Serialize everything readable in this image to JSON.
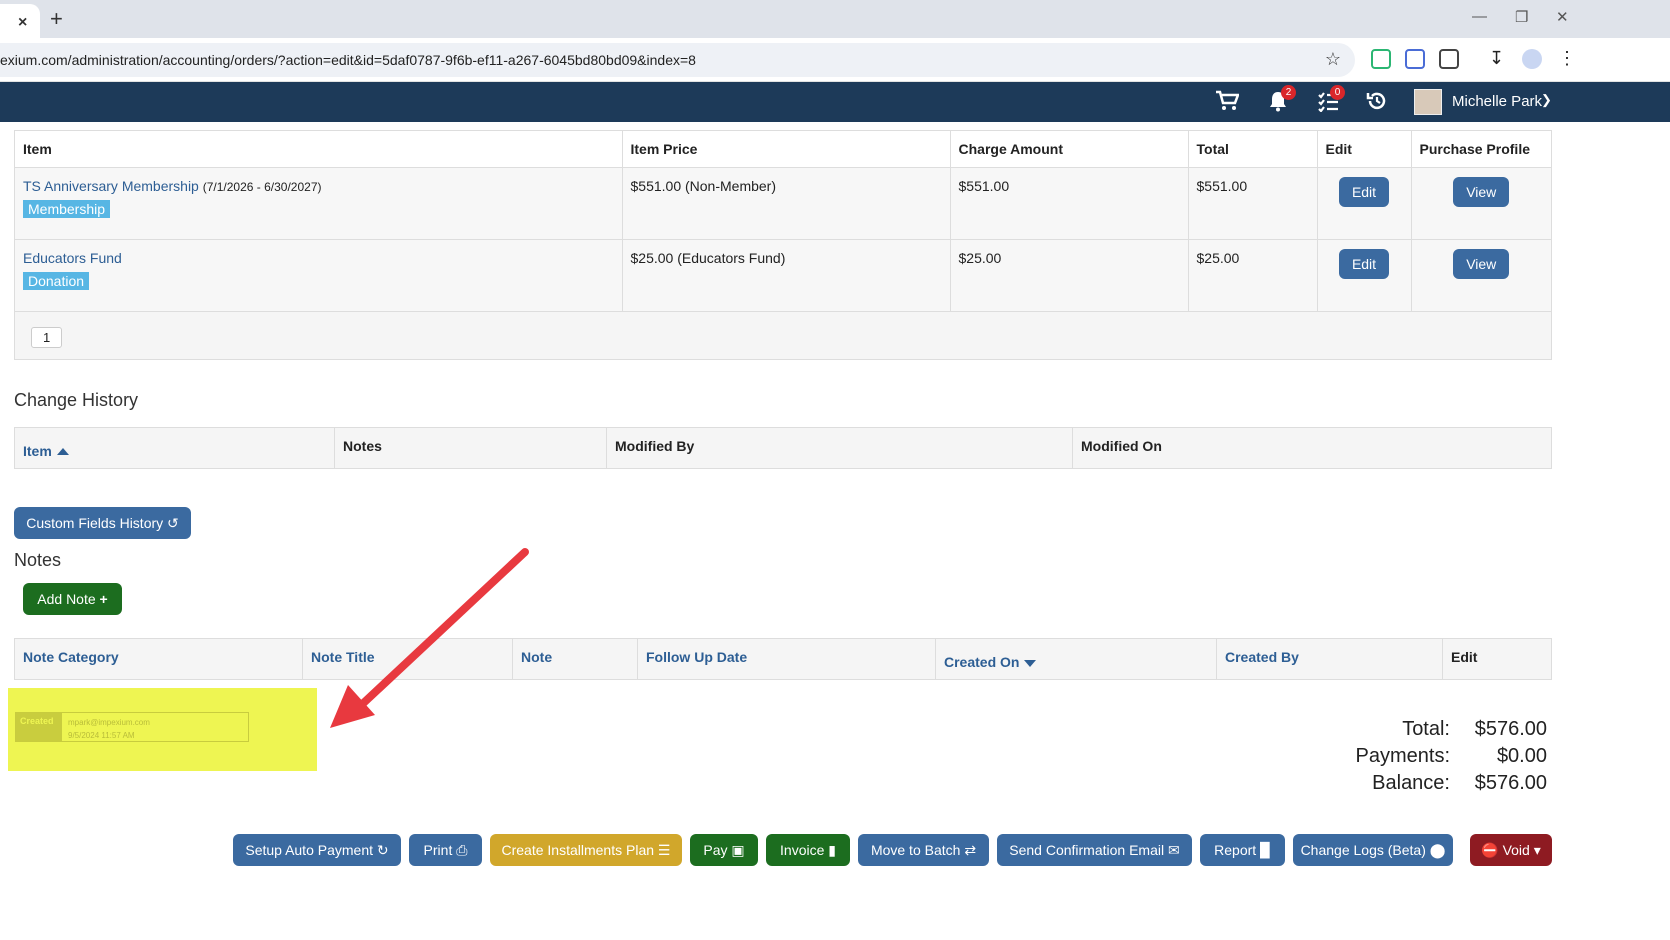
{
  "browser": {
    "url": "exium.com/administration/accounting/orders/?action=edit&id=5daf0787-9f6b-ef11-a267-6045bd80bd09&index=8",
    "new_tab": "+",
    "close_tab": "×"
  },
  "header": {
    "user_name": "Michelle Park",
    "notification_count": "2",
    "task_count": "0"
  },
  "items_table": {
    "columns": [
      "Item",
      "Item Price",
      "Charge Amount",
      "Total",
      "Edit",
      "Purchase Profile"
    ],
    "rows": [
      {
        "name": "TS Anniversary Membership",
        "dates": "(7/1/2026 - 6/30/2027)",
        "tag": "Membership",
        "price": "$551.00 (Non-Member)",
        "charge": "$551.00",
        "total": "$551.00",
        "edit": "Edit",
        "view": "View"
      },
      {
        "name": "Educators Fund",
        "dates": "",
        "tag": "Donation",
        "price": "$25.00 (Educators Fund)",
        "charge": "$25.00",
        "total": "$25.00",
        "edit": "Edit",
        "view": "View"
      }
    ],
    "page": "1"
  },
  "change_history": {
    "title": "Change History",
    "columns": [
      "Item",
      "Notes",
      "Modified By",
      "Modified On"
    ]
  },
  "custom_fields_btn": "Custom Fields History",
  "notes": {
    "title": "Notes",
    "add_note": "Add Note",
    "columns": [
      "Note Category",
      "Note Title",
      "Note",
      "Follow Up Date",
      "Created On",
      "Created By",
      "Edit"
    ]
  },
  "highlight": {
    "label": "Created",
    "email": "mpark@impexium.com",
    "timestamp": "9/5/2024 11:57 AM"
  },
  "totals": {
    "total_label": "Total:",
    "total": "$576.00",
    "payments_label": "Payments:",
    "payments": "$0.00",
    "balance_label": "Balance:",
    "balance": "$576.00"
  },
  "actions": {
    "setup_auto_payment": "Setup Auto Payment",
    "print": "Print",
    "installments": "Create Installments Plan",
    "pay": "Pay",
    "invoice": "Invoice",
    "move_batch": "Move to Batch",
    "send_email": "Send Confirmation Email",
    "report": "Report",
    "change_logs": "Change Logs (Beta)",
    "void": "Void"
  },
  "colors": {
    "header_bg": "#1d3a59",
    "primary_btn": "#3b6aa0",
    "success_btn": "#1c6d1f",
    "warning_btn": "#d1a72b",
    "danger_btn": "#8e1b22",
    "tag_bg": "#57b6e4",
    "highlight": "#eef552",
    "arrow": "#e8393f"
  }
}
